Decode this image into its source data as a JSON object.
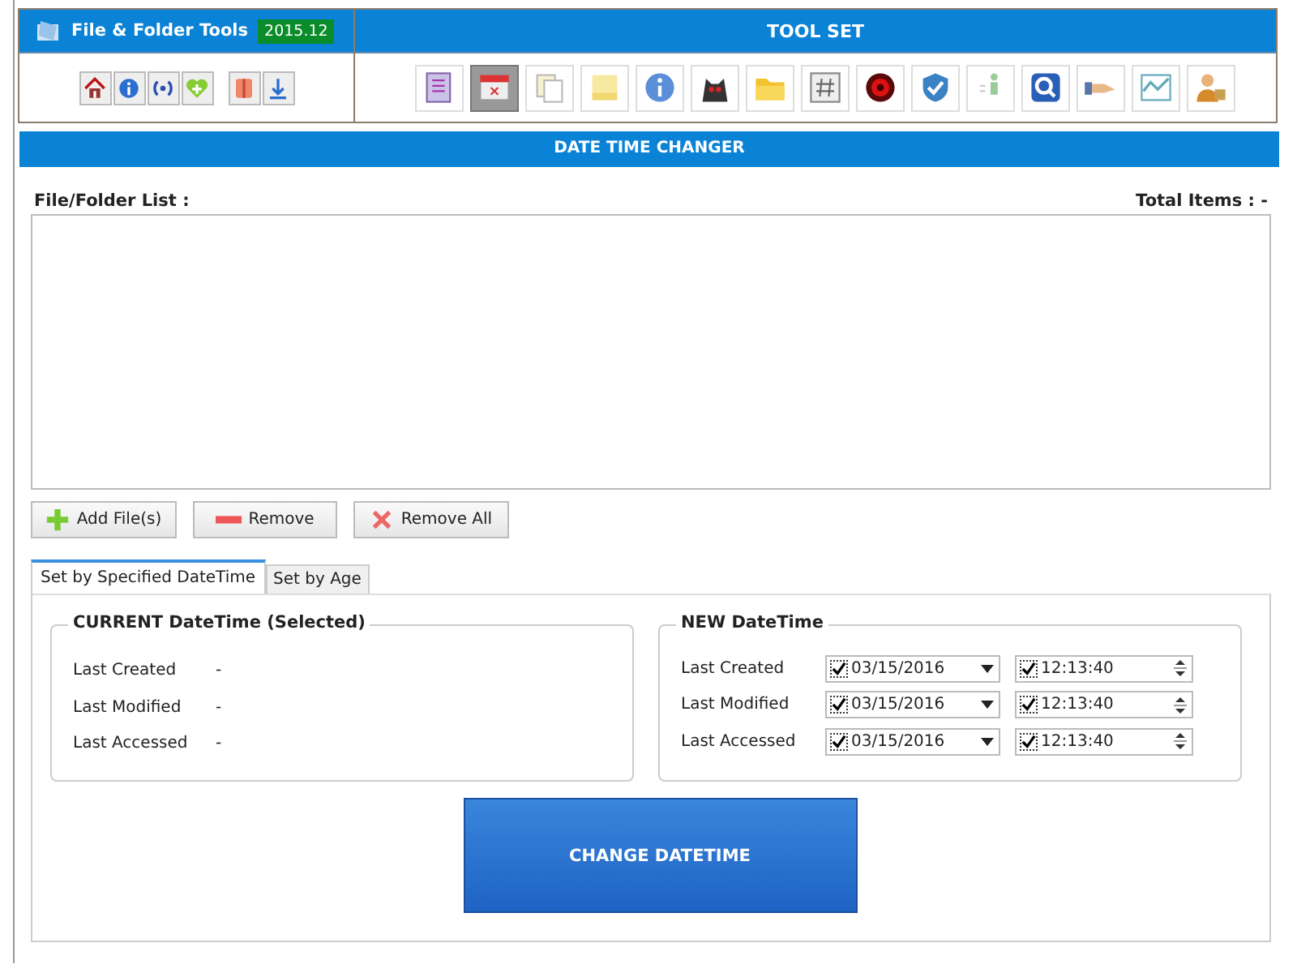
{
  "app": {
    "title": "File & Folder Tools",
    "version": "2015.12"
  },
  "quick_buttons": [
    {
      "selected": false
    },
    {
      "selected": false
    },
    {
      "selected": false
    },
    {
      "selected": false
    },
    {
      "selected": false
    },
    {
      "selected": false
    }
  ],
  "toolset": {
    "title": "TOOL SET",
    "tools": [
      {
        "selected": false
      },
      {
        "selected": true
      },
      {
        "selected": false
      },
      {
        "selected": false
      },
      {
        "selected": false
      },
      {
        "selected": false
      },
      {
        "selected": false
      },
      {
        "selected": false
      },
      {
        "selected": false
      },
      {
        "selected": false
      },
      {
        "selected": false
      },
      {
        "selected": false
      },
      {
        "selected": false
      },
      {
        "selected": false
      },
      {
        "selected": false
      }
    ]
  },
  "section_title": "DATE TIME CHANGER",
  "list": {
    "label": "File/Folder List :",
    "total_label": "Total Items : -"
  },
  "buttons": [
    {
      "kind": "add",
      "label": "Add File(s)"
    },
    {
      "kind": "remove",
      "label": "Remove"
    },
    {
      "kind": "remove_all",
      "label": "Remove All"
    }
  ],
  "tabs": [
    {
      "label": "Set by Specified DateTime",
      "selected": true
    },
    {
      "label": "Set by Age",
      "selected": false
    }
  ],
  "current": {
    "title": "CURRENT DateTime (Selected)",
    "rows": [
      {
        "label": "Last Created",
        "value": "-"
      },
      {
        "label": "Last Modified",
        "value": "-"
      },
      {
        "label": "Last Accessed",
        "value": "-"
      }
    ]
  },
  "new": {
    "title": "NEW DateTime",
    "rows": [
      {
        "label": "Last Created",
        "date": "03/15/2016",
        "date_checked": true,
        "time": "12:13:40",
        "time_checked": true
      },
      {
        "label": "Last Modified",
        "date": "03/15/2016",
        "date_checked": true,
        "time": "12:13:40",
        "time_checked": true
      },
      {
        "label": "Last Accessed",
        "date": "03/15/2016",
        "date_checked": true,
        "time": "12:13:40",
        "time_checked": true
      }
    ]
  },
  "action_button": "CHANGE DATETIME"
}
